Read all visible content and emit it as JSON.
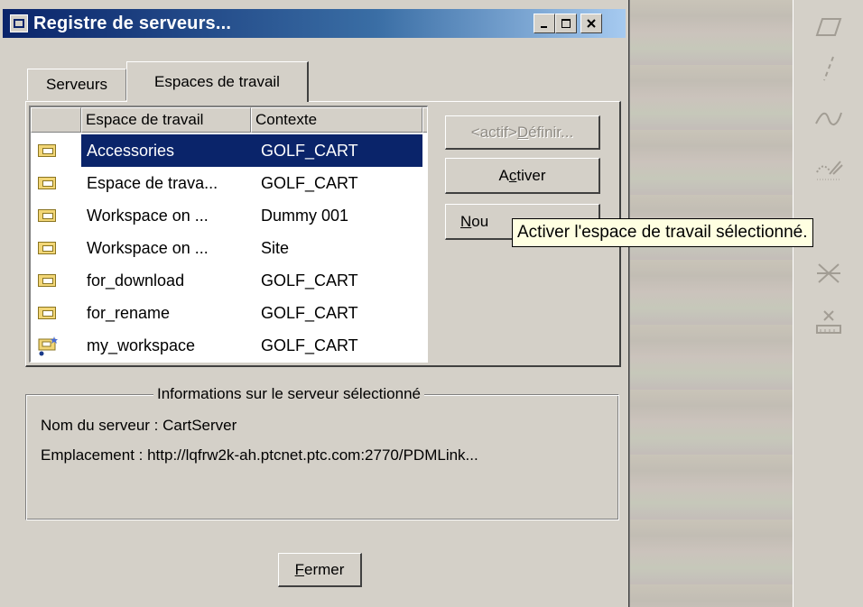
{
  "window": {
    "title": "Registre de serveurs...",
    "minimize": "_",
    "maximize": "□",
    "close": "✕"
  },
  "tabs": [
    {
      "label": "Serveurs",
      "active": false
    },
    {
      "label": "Espaces de travail",
      "active": true
    }
  ],
  "list": {
    "columns": [
      "Espace de travail",
      "Contexte"
    ],
    "rows": [
      {
        "workspace": "Accessories",
        "context": "GOLF_CART",
        "selected": true,
        "icon": "workspace-folder-icon"
      },
      {
        "workspace": "Espace de trava...",
        "context": "GOLF_CART",
        "icon": "workspace-folder-icon"
      },
      {
        "workspace": "Workspace on ...",
        "context": "Dummy 001",
        "icon": "workspace-folder-icon"
      },
      {
        "workspace": "Workspace on ...",
        "context": "Site",
        "icon": "workspace-folder-icon"
      },
      {
        "workspace": "for_download",
        "context": "GOLF_CART",
        "icon": "workspace-folder-icon"
      },
      {
        "workspace": "for_rename",
        "context": "GOLF_CART",
        "icon": "workspace-folder-icon"
      },
      {
        "workspace": "my_workspace",
        "context": "GOLF_CART",
        "icon": "active-workspace-icon"
      }
    ]
  },
  "buttons": {
    "define_prefix": "<actif>",
    "define_mnemonic": "D",
    "define_rest": "éfinir...",
    "activate_pre": "A",
    "activate_mnemonic": "c",
    "activate_rest": "tiver",
    "new_mnemonic": "N",
    "new_rest": "ou",
    "close_mnemonic": "F",
    "close_rest": "ermer"
  },
  "tooltip": "Activer l'espace de travail sélectionné.",
  "server_info": {
    "legend": "Informations sur le serveur sélectionné",
    "name_line": "Nom du serveur : CartServer",
    "location_line": "Emplacement : http://lqfrw2k-ah.ptcnet.ptc.com:2770/PDMLink..."
  },
  "toolbar_icons": [
    "parallelogram-icon",
    "dashed-line-icon",
    "curve-icon",
    "hatch-icon",
    "asterisk-icon",
    "dimension-icon"
  ]
}
